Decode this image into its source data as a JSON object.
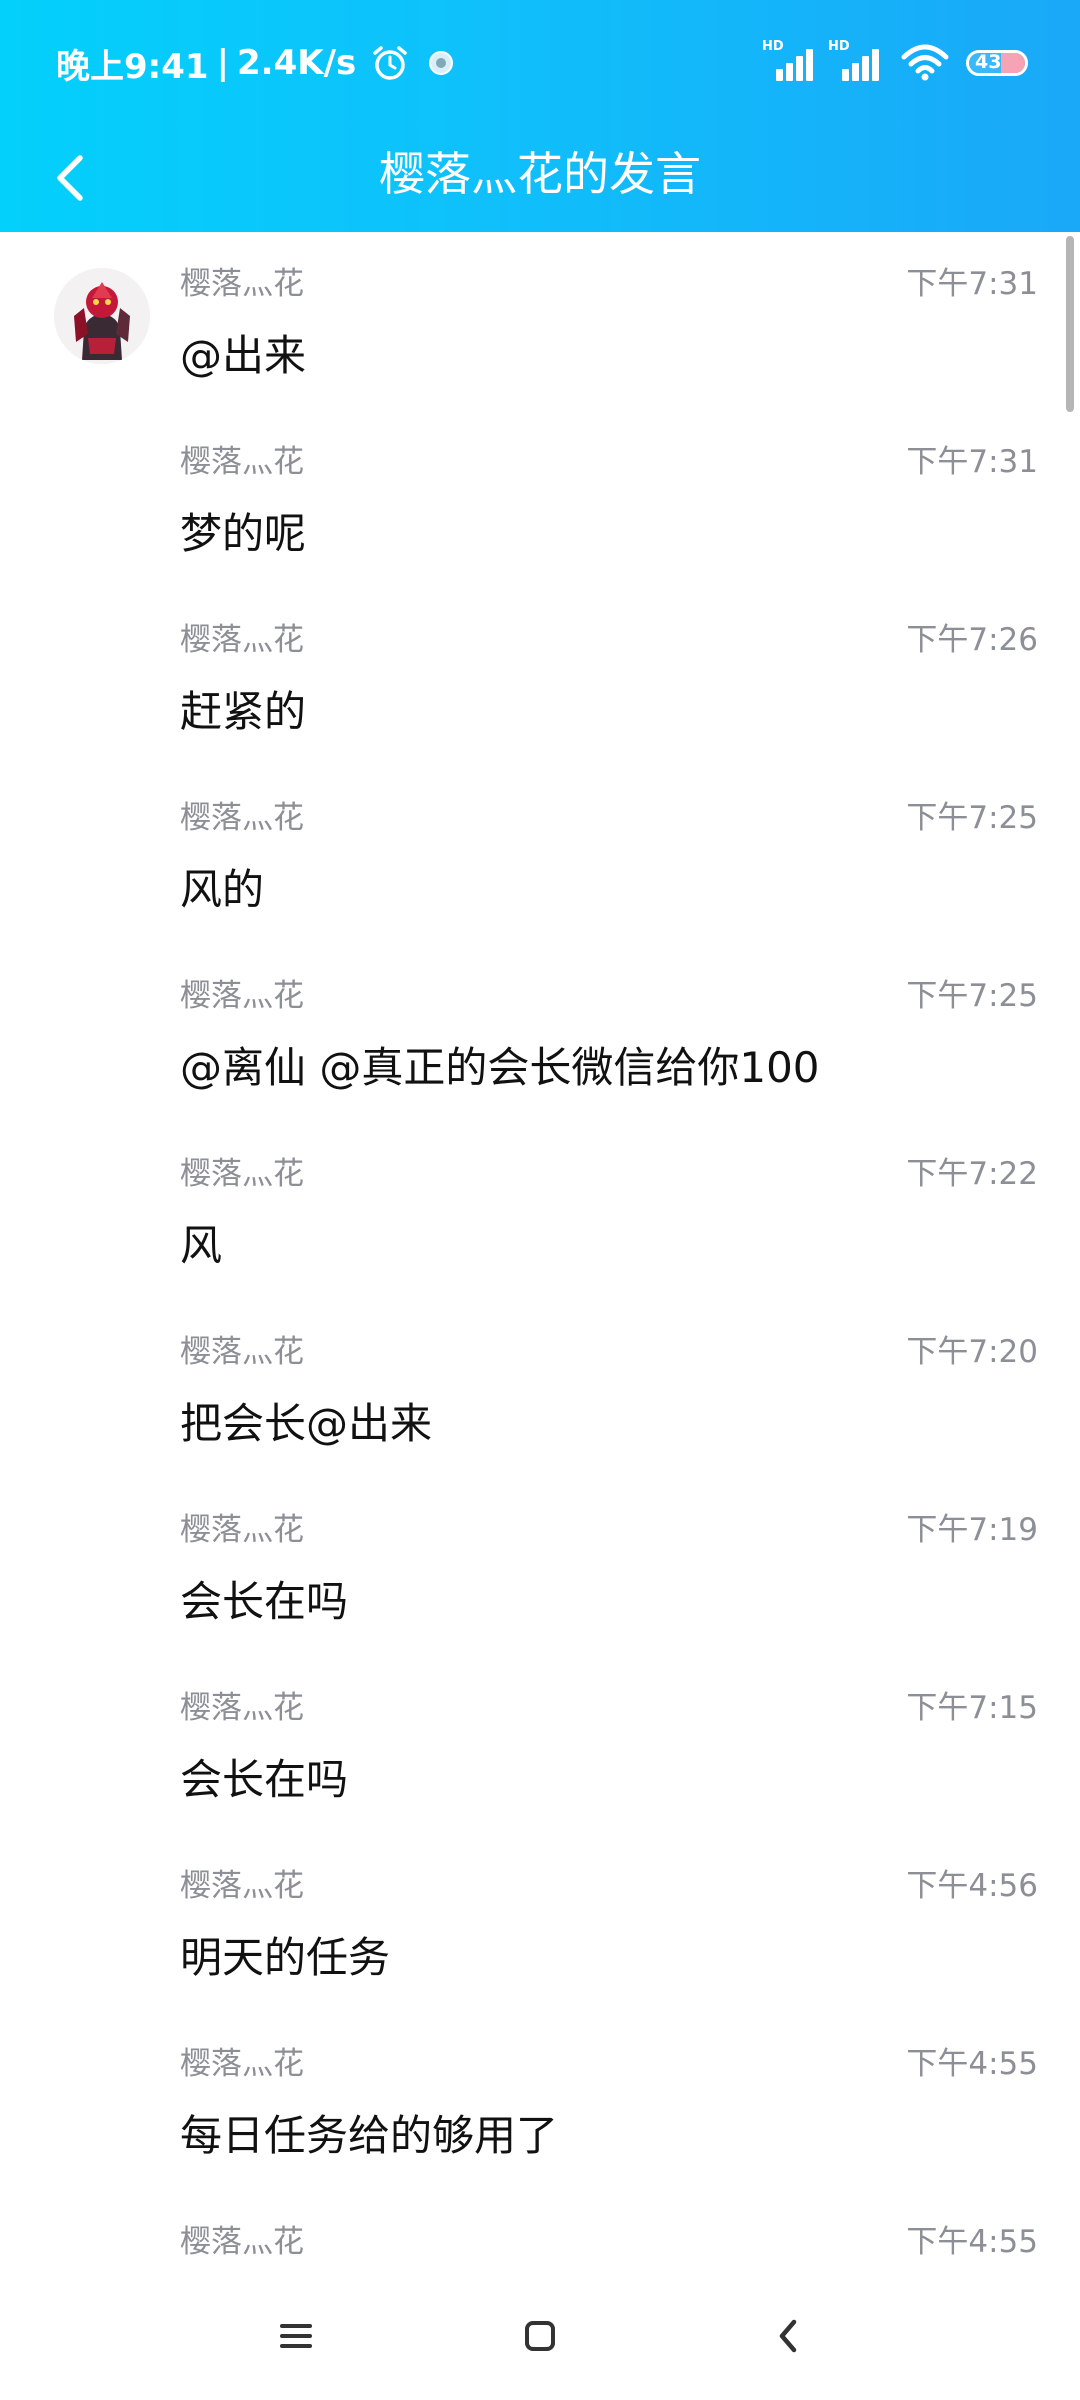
{
  "status_bar": {
    "time": "晚上9:41",
    "separator": "|",
    "speed": "2.4K/s",
    "hd1": "HD",
    "hd2": "HD",
    "battery": "43",
    "battery_level": 0.43
  },
  "header": {
    "title": "樱落灬花的发言"
  },
  "messages": [
    {
      "sender": "樱落灬花",
      "time": "下午7:31",
      "text": "@出来",
      "has_avatar": true
    },
    {
      "sender": "樱落灬花",
      "time": "下午7:31",
      "text": "梦的呢"
    },
    {
      "sender": "樱落灬花",
      "time": "下午7:26",
      "text": "赶紧的"
    },
    {
      "sender": "樱落灬花",
      "time": "下午7:25",
      "text": "风的"
    },
    {
      "sender": "樱落灬花",
      "time": "下午7:25",
      "text": "@离仙 @真正的会长微信给你100"
    },
    {
      "sender": "樱落灬花",
      "time": "下午7:22",
      "text": "风"
    },
    {
      "sender": "樱落灬花",
      "time": "下午7:20",
      "text": "把会长@出来"
    },
    {
      "sender": "樱落灬花",
      "time": "下午7:19",
      "text": "会长在吗"
    },
    {
      "sender": "樱落灬花",
      "time": "下午7:15",
      "text": "会长在吗"
    },
    {
      "sender": "樱落灬花",
      "time": "下午4:56",
      "text": "明天的任务"
    },
    {
      "sender": "樱落灬花",
      "time": "下午4:55",
      "text": "每日任务给的够用了"
    },
    {
      "sender": "樱落灬花",
      "time": "下午4:55",
      "text": ""
    }
  ],
  "icons": {
    "back": "chevron-left-icon",
    "alarm": "alarm-clock-icon",
    "app_notification": "app-notification-icon",
    "wifi": "wifi-icon",
    "menu": "menu-icon",
    "home": "home-icon",
    "nav_back": "back-icon"
  },
  "colors": {
    "header_start": "#03d0fb",
    "header_end": "#1aa8f8",
    "meta_text": "#8c8f96",
    "message_text": "#111111"
  }
}
